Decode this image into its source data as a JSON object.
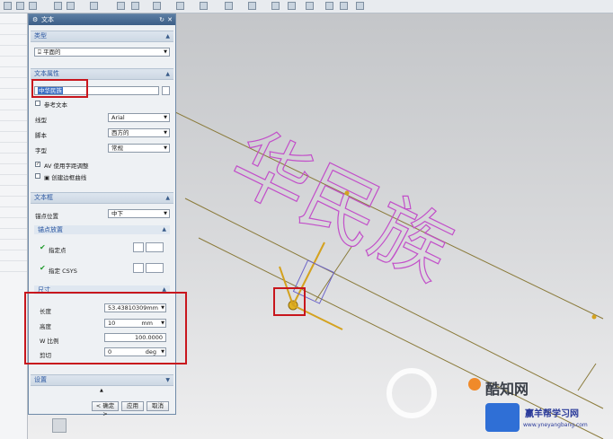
{
  "dialog": {
    "title": "文本",
    "sections": {
      "type": {
        "header": "类型",
        "value": "平面的"
      },
      "text_props": {
        "header": "文本属性",
        "text_value": "中华民族",
        "ref_text_label": "参考文本",
        "line_label": "线型",
        "line_value": "Arial",
        "script_label": "脚本",
        "script_value": "西方的",
        "style_label": "字型",
        "style_value": "常规",
        "kerning_label": "使用字距调整",
        "outline_label": "创建边框曲线"
      },
      "text_frame": {
        "header": "文本框",
        "anchor_label": "锚点位置",
        "anchor_value": "中下",
        "anchor_setting_header": "锚点放置",
        "point_label": "指定点",
        "csys_label": "指定 CSYS"
      },
      "dimensions": {
        "header": "尺寸",
        "length_label": "长度",
        "length_value": "53.43810309",
        "length_unit": "mm",
        "height_label": "高度",
        "height_value": "10",
        "height_unit": "mm",
        "w_ratio_label": "W 比例",
        "w_ratio_value": "100.0000",
        "shear_label": "剪切",
        "shear_value": "0",
        "shear_unit": "deg"
      },
      "settings": {
        "header": "设置"
      }
    },
    "buttons": {
      "ok": "< 确定 >",
      "apply": "应用",
      "cancel": "取消"
    }
  },
  "viewport": {
    "text_preview": "华民族",
    "preview_color": "#c24fc9"
  },
  "watermark": {
    "brand": "酷知网",
    "site_name": "赢羊帮学习网",
    "site_url": "www.yneyangbang.com"
  },
  "colors": {
    "accent": "#2a56a0",
    "highlight_box": "#c8161d",
    "curve_line": "#8a7a3a"
  }
}
